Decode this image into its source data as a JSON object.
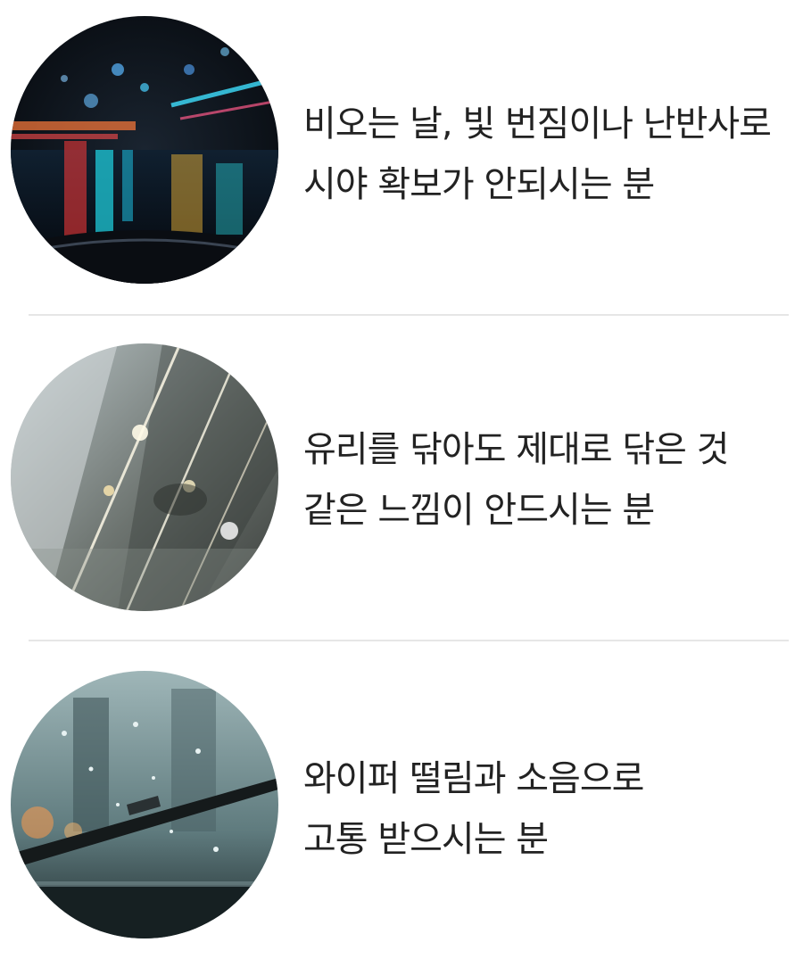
{
  "items": [
    {
      "image": "night-rain-windshield-lights",
      "lines": [
        "비오는 날, 빛 번짐이나 난반사로",
        "시야 확보가 안되시는 분"
      ]
    },
    {
      "image": "smudged-windshield-glare",
      "lines": [
        "유리를 닦아도 제대로 닦은 것",
        "같은 느낌이 안드시는 분"
      ]
    },
    {
      "image": "wiper-blade-rain-drops",
      "lines": [
        "와이퍼 떨림과 소음으로",
        "고통 받으시는 분"
      ]
    }
  ],
  "colors": {
    "text": "#222222",
    "divider": "#e6e6e6",
    "background": "#ffffff"
  }
}
